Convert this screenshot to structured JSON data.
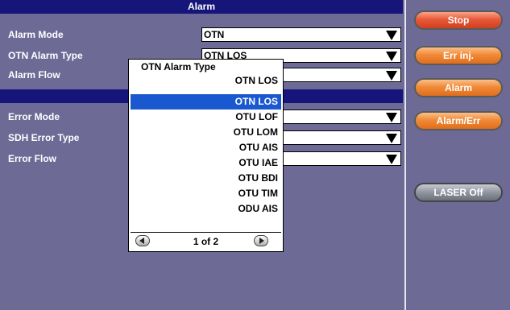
{
  "alarm_section": {
    "header": "Alarm",
    "rows": [
      {
        "label": "Alarm Mode",
        "value": "OTN"
      },
      {
        "label": "OTN Alarm Type",
        "value": "OTN LOS"
      },
      {
        "label": "Alarm Flow",
        "value": ""
      }
    ]
  },
  "error_section": {
    "header": "",
    "rows": [
      {
        "label": "Error Mode",
        "value": ""
      },
      {
        "label": "SDH Error Type",
        "value": ""
      },
      {
        "label": "Error Flow",
        "value": ""
      }
    ]
  },
  "popup": {
    "title": "OTN Alarm Type",
    "current": "OTN LOS",
    "options": [
      "OTN LOS",
      "OTU LOF",
      "OTU LOM",
      "OTU AIS",
      "OTU IAE",
      "OTU BDI",
      "OTU TIM",
      "ODU AIS"
    ],
    "selected_index": 0,
    "pager": "1 of 2"
  },
  "sidebar": {
    "buttons": [
      {
        "label": "Stop",
        "style": "red"
      },
      {
        "label": "Err inj.",
        "style": "orange"
      },
      {
        "label": "Alarm",
        "style": "orange"
      },
      {
        "label": "Alarm/Err",
        "style": "orange"
      },
      {
        "label": "LASER Off",
        "style": "gray"
      }
    ]
  },
  "colors": {
    "background": "#6e6a96",
    "header": "#15157a",
    "selection": "#1a58d0",
    "stop_button": "#e8593a",
    "action_button": "#f08a38"
  }
}
